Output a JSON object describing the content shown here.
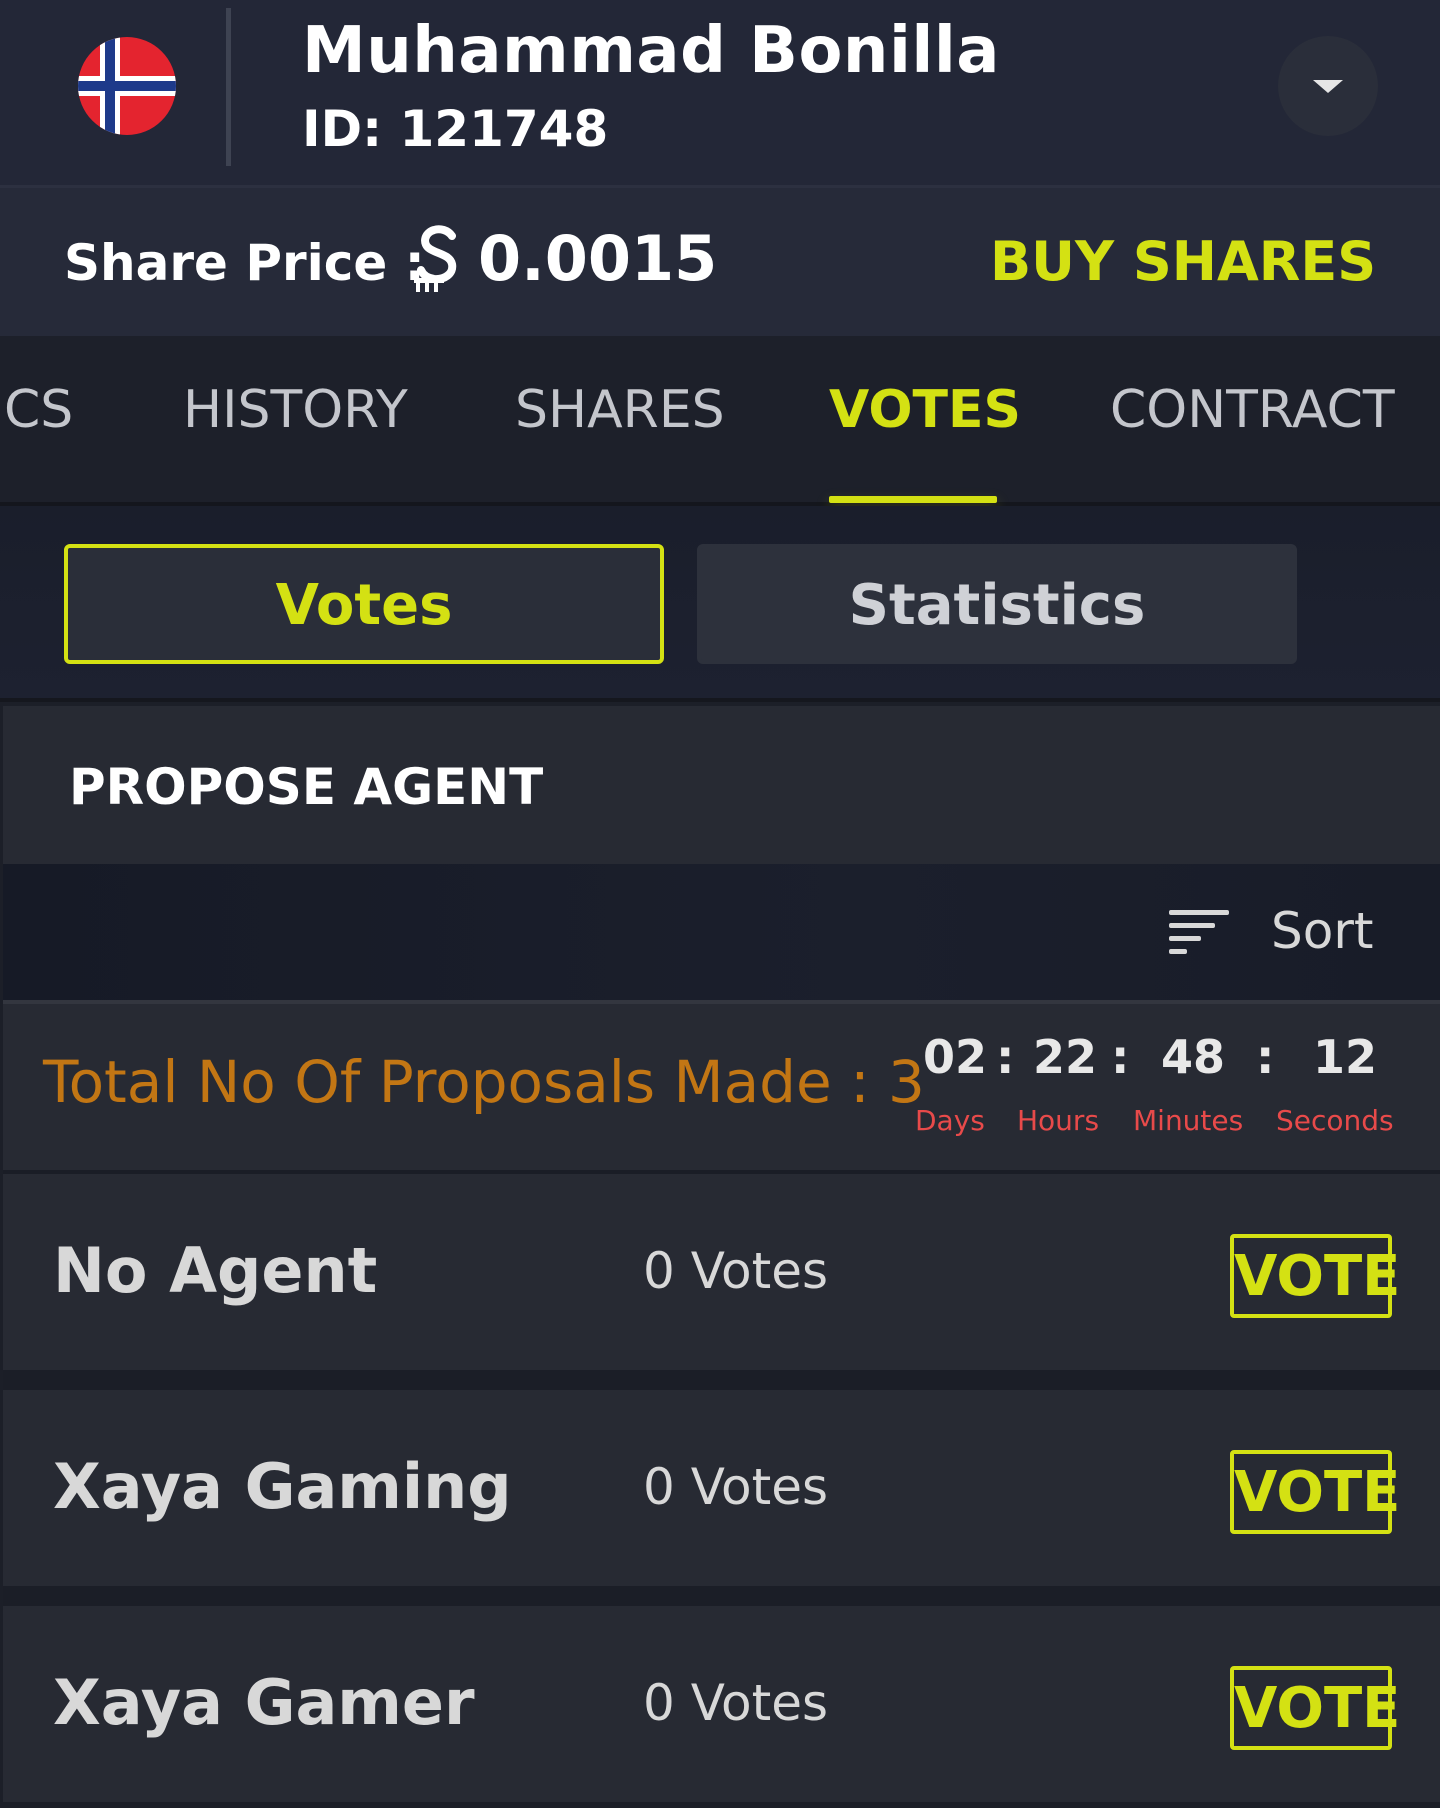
{
  "header": {
    "player_name": "Muhammad Bonilla",
    "player_id": "ID: 121748",
    "flag_icon": "norway-flag-icon",
    "dropdown_icon": "caret-down-icon"
  },
  "price_bar": {
    "label": "Share Price :",
    "currency_icon": "currency-icon",
    "value": "0.0015",
    "buy_label": "BUY SHARES"
  },
  "tabs": [
    {
      "label": "CS",
      "active": false
    },
    {
      "label": "HISTORY",
      "active": false
    },
    {
      "label": "SHARES",
      "active": false
    },
    {
      "label": "VOTES",
      "active": true
    },
    {
      "label": "CONTRACT",
      "active": false
    }
  ],
  "segments": {
    "votes": "Votes",
    "statistics": "Statistics",
    "active": "votes"
  },
  "propose": {
    "label": "PROPOSE AGENT"
  },
  "sort": {
    "label": "Sort",
    "icon": "sort-icon"
  },
  "proposals": {
    "total_text": "Total No Of Proposals Made : 3",
    "timer": {
      "days": "02",
      "hours": "22",
      "minutes": "48",
      "seconds": "12",
      "separator": ":",
      "days_label": "Days",
      "hours_label": "Hours",
      "minutes_label": "Minutes",
      "seconds_label": "Seconds"
    }
  },
  "agents": [
    {
      "name": "No Agent",
      "votes": "0 Votes",
      "button": "VOTE"
    },
    {
      "name": "Xaya Gaming",
      "votes": "0 Votes",
      "button": "VOTE"
    },
    {
      "name": "Xaya Gamer",
      "votes": "0 Votes",
      "button": "VOTE"
    }
  ],
  "colors": {
    "accent": "#d4e113",
    "proposals_text": "#c27614",
    "timer_label": "#e84a4a",
    "background": "#1c1f28"
  }
}
